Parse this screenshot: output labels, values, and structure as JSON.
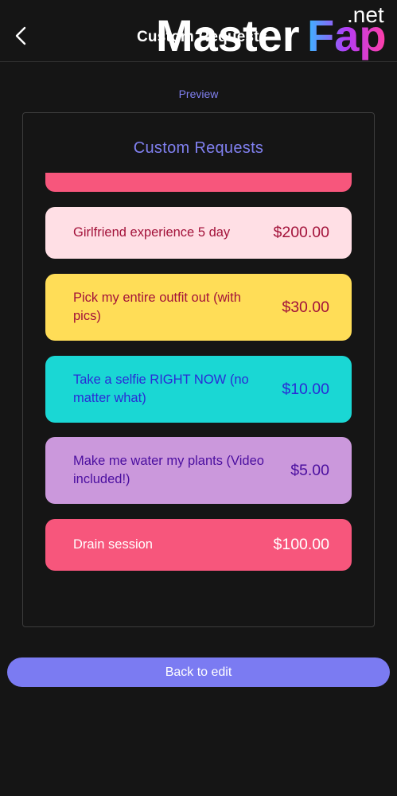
{
  "header": {
    "title": "Custom Requests",
    "back_icon": "chevron-left-icon",
    "watermark": {
      "brand": "MasterFap",
      "suffix": ".net"
    }
  },
  "preview_label": "Preview",
  "preview_card": {
    "title": "Custom Requests",
    "items": [
      {
        "name": "Girlfriend experience 5 day",
        "price": "$200.00",
        "bg": "#ffdfe5",
        "fg": "#a3123a"
      },
      {
        "name": "Pick my entire outfit out (with pics)",
        "price": "$30.00",
        "bg": "#ffdd57",
        "fg": "#a3123a"
      },
      {
        "name": "Take a selfie RIGHT NOW (no matter what)",
        "price": "$10.00",
        "bg": "#1ad7d4",
        "fg": "#2a2bd6"
      },
      {
        "name": "Make me water my plants (Video included!)",
        "price": "$5.00",
        "bg": "#cb98dc",
        "fg": "#4a0e9f"
      },
      {
        "name": "Drain session",
        "price": "$100.00",
        "bg": "#f7567c",
        "fg": "#ffffff"
      }
    ]
  },
  "back_button_label": "Back to edit"
}
